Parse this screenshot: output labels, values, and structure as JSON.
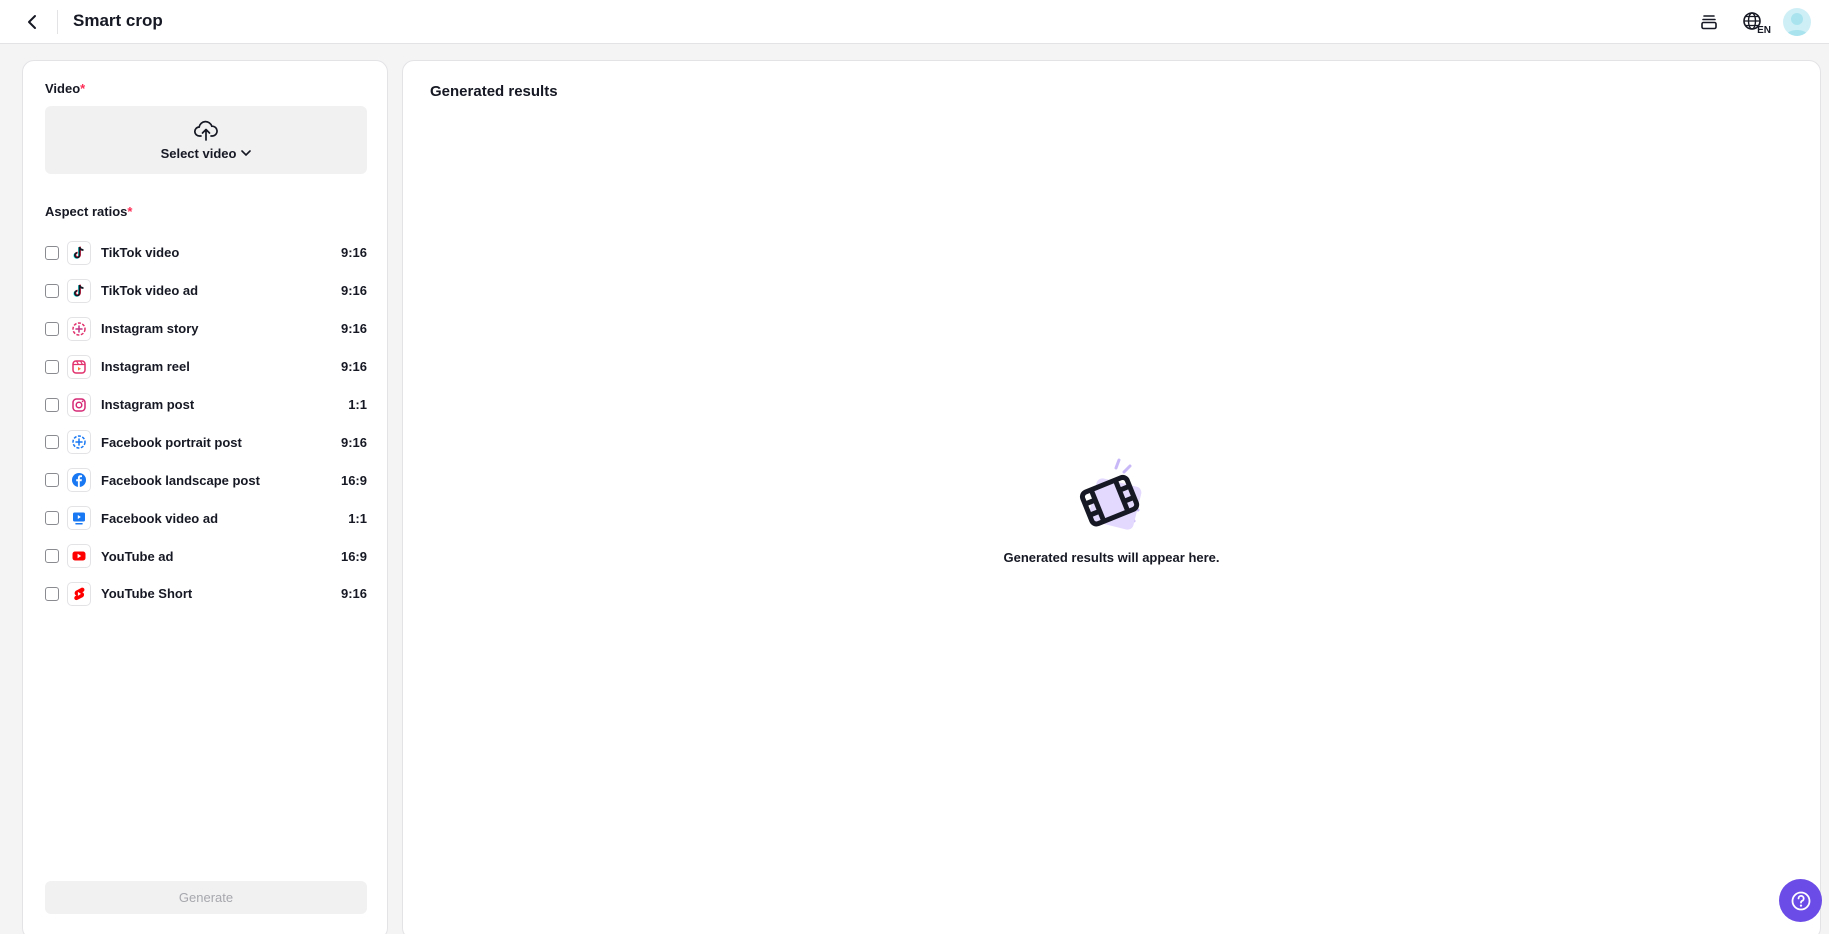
{
  "header": {
    "title": "Smart crop",
    "language": "EN"
  },
  "form": {
    "video_label": "Video",
    "required_mark": "*",
    "select_video": "Select video",
    "aspect_label": "Aspect ratios",
    "generate": "Generate"
  },
  "ratios": [
    {
      "name": "TikTok video",
      "ratio": "9:16",
      "icon": "tiktok-icon"
    },
    {
      "name": "TikTok video ad",
      "ratio": "9:16",
      "icon": "tiktok-icon"
    },
    {
      "name": "Instagram story",
      "ratio": "9:16",
      "icon": "instagram-story-icon"
    },
    {
      "name": "Instagram reel",
      "ratio": "9:16",
      "icon": "instagram-reel-icon"
    },
    {
      "name": "Instagram post",
      "ratio": "1:1",
      "icon": "instagram-icon"
    },
    {
      "name": "Facebook portrait post",
      "ratio": "9:16",
      "icon": "facebook-story-icon"
    },
    {
      "name": "Facebook landscape post",
      "ratio": "16:9",
      "icon": "facebook-icon"
    },
    {
      "name": "Facebook video ad",
      "ratio": "1:1",
      "icon": "facebook-video-icon"
    },
    {
      "name": "YouTube ad",
      "ratio": "16:9",
      "icon": "youtube-icon"
    },
    {
      "name": "YouTube Short",
      "ratio": "9:16",
      "icon": "youtube-shorts-icon"
    }
  ],
  "results": {
    "title": "Generated results",
    "empty_text": "Generated results will appear here."
  },
  "colors": {
    "accent": "#6c4ce6",
    "required": "#fe2c55"
  }
}
